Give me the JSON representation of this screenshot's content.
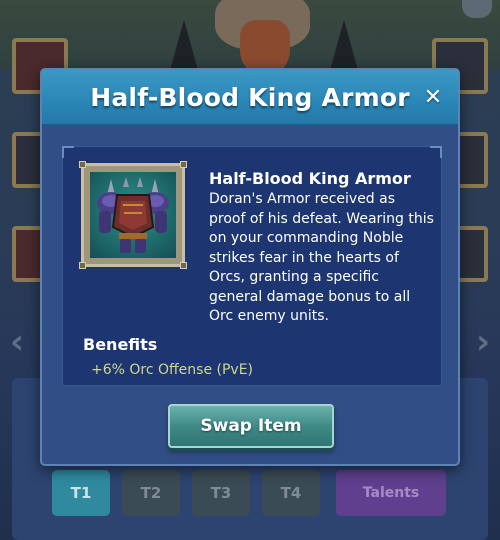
{
  "dialog": {
    "title": "Half-Blood King Armor",
    "close_icon": "close-icon",
    "close_glyph": "✕"
  },
  "item": {
    "name": "Half-Blood King Armor",
    "description": "Doran's Armor received as proof of his defeat. Wearing this on your commanding Noble strikes fear in the hearts of Orcs, granting a specific general damage bonus to all Orc enemy units.",
    "icon": "armor-icon"
  },
  "benefits": {
    "label": "Benefits",
    "items": [
      "+6% Orc Offense (PvE)"
    ]
  },
  "actions": {
    "swap_label": "Swap Item"
  },
  "background": {
    "tabs": [
      "T1",
      "T2",
      "T3",
      "T4"
    ],
    "talents_label": "Talents"
  },
  "colors": {
    "header": "#2a86b6",
    "dialog_bg": "#314f86",
    "panel_bg": "#1d3672",
    "benefit_text": "#cdd78e",
    "button": "#3f8a88"
  }
}
